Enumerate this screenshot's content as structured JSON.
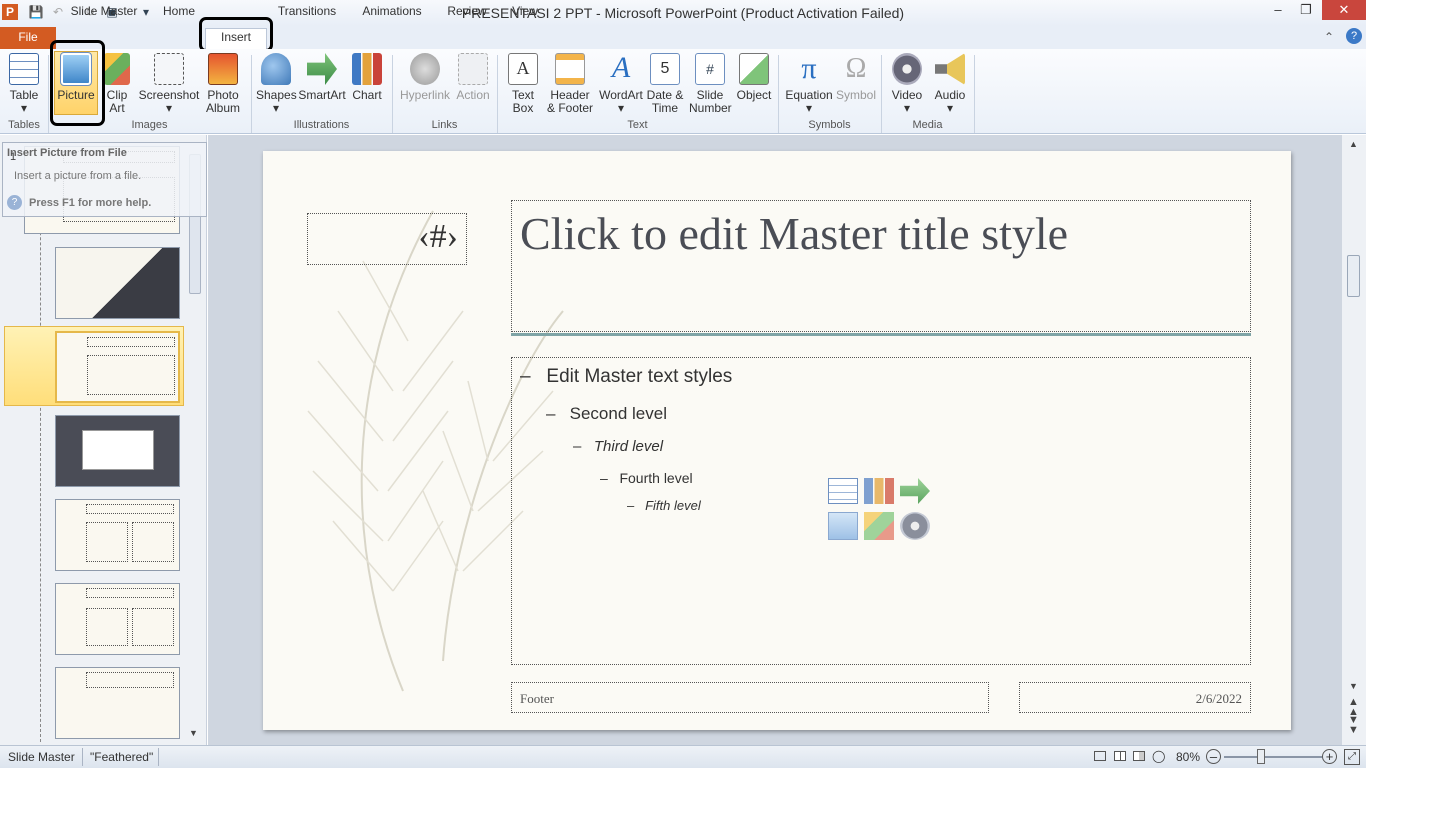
{
  "window": {
    "title": "PRESENTASI 2 PPT  -  Microsoft PowerPoint (Product Activation Failed)"
  },
  "tabs": {
    "file": "File",
    "items": [
      "Slide Master",
      "Home",
      "Insert",
      "Transitions",
      "Animations",
      "Review",
      "View"
    ],
    "active": "Insert"
  },
  "ribbon": {
    "buttons": {
      "table": "Table",
      "picture": "Picture",
      "clipart": "Clip Art",
      "screenshot": "Screenshot",
      "photoalbum": "Photo Album",
      "shapes": "Shapes",
      "smartart": "SmartArt",
      "chart": "Chart",
      "hyperlink": "Hyperlink",
      "action": "Action",
      "textbox": "Text Box",
      "header": "Header & Footer",
      "wordart": "WordArt",
      "datetime": "Date & Time",
      "slidenumber": "Slide Number",
      "object": "Object",
      "equation": "Equation",
      "symbol": "Symbol",
      "video": "Video",
      "audio": "Audio"
    },
    "groups": {
      "tables": "Tables",
      "images": "Images",
      "illustrations": "Illustrations",
      "links": "Links",
      "text": "Text",
      "symbols": "Symbols",
      "media": "Media"
    }
  },
  "tooltip": {
    "title": "Insert Picture from File",
    "desc": "Insert a picture from a file.",
    "help": "Press F1 for more help."
  },
  "thumbs": {
    "first_number": "1"
  },
  "slide": {
    "title": "Click to edit Master title style",
    "number_placeholder": "‹#›",
    "levels": [
      "Edit Master text styles",
      "Second level",
      "Third level",
      "Fourth level",
      "Fifth level"
    ],
    "footer": "Footer",
    "date": "2/6/2022"
  },
  "status": {
    "view": "Slide Master",
    "theme": "\"Feathered\"",
    "zoom": "80%"
  }
}
